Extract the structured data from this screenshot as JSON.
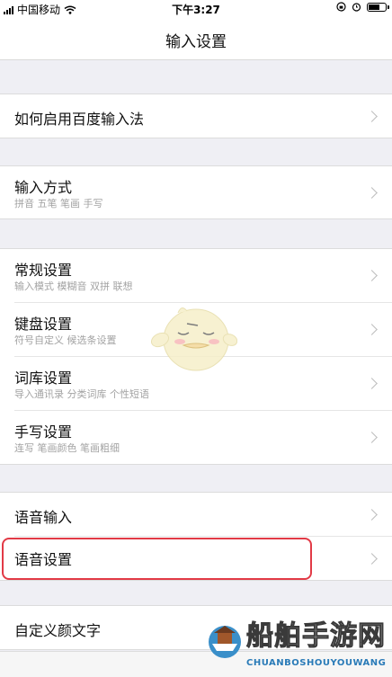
{
  "status_bar": {
    "carrier": "中国移动",
    "time": "下午3:27"
  },
  "navbar": {
    "title": "输入设置"
  },
  "groups": [
    {
      "rows": [
        {
          "label": "如何启用百度输入法",
          "sub": ""
        }
      ]
    },
    {
      "rows": [
        {
          "label": "输入方式",
          "sub": "拼音 五笔 笔画 手写"
        }
      ]
    },
    {
      "rows": [
        {
          "label": "常规设置",
          "sub": "输入模式 模糊音 双拼 联想"
        },
        {
          "label": "键盘设置",
          "sub": "符号自定义 候选条设置"
        },
        {
          "label": "词库设置",
          "sub": "导入通讯录 分类词库 个性短语"
        },
        {
          "label": "手写设置",
          "sub": "连写 笔画颜色 笔画粗细"
        }
      ]
    },
    {
      "rows": [
        {
          "label": "语音输入",
          "sub": ""
        },
        {
          "label": "语音设置",
          "sub": ""
        }
      ]
    },
    {
      "rows": [
        {
          "label": "自定义颜文字",
          "sub": ""
        }
      ]
    }
  ],
  "watermark": {
    "brand_cn": "船舶手游网",
    "brand_en": "CHUANBOSHOUYOUWANG"
  },
  "colors": {
    "highlight": "#e23a46",
    "background": "#efeff4"
  }
}
